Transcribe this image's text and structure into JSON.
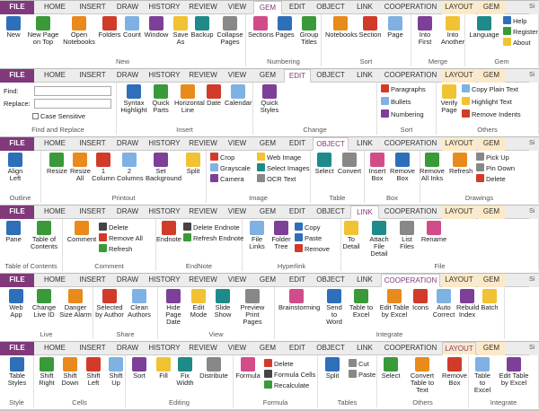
{
  "colors": {
    "file": "#80397b",
    "accent": "#7d3f98"
  },
  "r1": {
    "tabs": [
      "FILE",
      "HOME",
      "INSERT",
      "DRAW",
      "HISTORY",
      "REVIEW",
      "VIEW",
      "GEM",
      "EDIT",
      "OBJECT",
      "LINK",
      "COOPERATION",
      "LAYOUT",
      "GEM"
    ],
    "btns": [
      "New",
      "New Page on Top",
      "Open Notebooks",
      "Folders",
      "Count",
      "Window",
      "Save As",
      "Backup",
      "Collapse Pages",
      "Sections",
      "Pages",
      "Group Titles",
      "Notebooks",
      "Section",
      "Page",
      "Into First",
      "Into Another",
      "Language"
    ],
    "small": [
      "Help",
      "Register",
      "About"
    ],
    "groups": [
      "New",
      "Numbering",
      "Sort",
      "Merge",
      "Gem"
    ]
  },
  "r2": {
    "tabs": [
      "FILE",
      "HOME",
      "INSERT",
      "DRAW",
      "HISTORY",
      "REVIEW",
      "VIEW",
      "GEM",
      "EDIT",
      "OBJECT",
      "LINK",
      "COOPERATION",
      "LAYOUT",
      "GEM"
    ],
    "find": "Find:",
    "replace": "Replace:",
    "case": "Case Sensitive",
    "btns": [
      "Syntax Highlight",
      "Quick Parts",
      "Horizontal Line",
      "Date",
      "Calendar",
      "Quick Styles",
      "Verify Page"
    ],
    "small": [
      "Paragraphs",
      "Bullets",
      "Numbering",
      "Copy Plain Text",
      "Highlight Text",
      "Remove Indents"
    ],
    "groups": [
      "Find and Replace",
      "Insert",
      "Change",
      "Sort",
      "Others"
    ]
  },
  "r3": {
    "tabs": [
      "FILE",
      "HOME",
      "INSERT",
      "DRAW",
      "HISTORY",
      "REVIEW",
      "VIEW",
      "GEM",
      "EDIT",
      "OBJECT",
      "LINK",
      "COOPERATION",
      "LAYOUT",
      "GEM"
    ],
    "btns": [
      "Align Left",
      "Resize",
      "Resize All",
      "1 Column",
      "2 Columns",
      "Set Background",
      "Split",
      "Select",
      "Convert",
      "Insert Box",
      "Remove Box",
      "Remove All Inks",
      "Refresh"
    ],
    "small": [
      "Crop",
      "Grayscale",
      "Camera",
      "Web Image",
      "Select Images",
      "OCR Text",
      "Pick Up",
      "Pin Down",
      "Delete"
    ],
    "groups": [
      "Outline",
      "Printout",
      "Image",
      "Table",
      "Box",
      "Drawings"
    ]
  },
  "r4": {
    "tabs": [
      "FILE",
      "HOME",
      "INSERT",
      "DRAW",
      "HISTORY",
      "REVIEW",
      "VIEW",
      "GEM",
      "EDIT",
      "OBJECT",
      "LINK",
      "COOPERATION",
      "LAYOUT",
      "GEM"
    ],
    "btns": [
      "Pane",
      "Table of Contents",
      "Comment",
      "Endnote",
      "File Links",
      "Folder Tree",
      "To Detail",
      "Attach File Detail",
      "List Files",
      "Rename"
    ],
    "small": [
      "Delete",
      "Remove All",
      "Refresh",
      "Delete Endnote",
      "Refresh Endnote",
      "Copy",
      "Paste",
      "Remove"
    ],
    "groups": [
      "Table of Contents",
      "Comment",
      "EndNote",
      "Hyperlink",
      "File"
    ]
  },
  "r5": {
    "tabs": [
      "FILE",
      "HOME",
      "INSERT",
      "DRAW",
      "HISTORY",
      "REVIEW",
      "VIEW",
      "GEM",
      "EDIT",
      "OBJECT",
      "LINK",
      "COOPERATION",
      "LAYOUT",
      "GEM"
    ],
    "btns": [
      "Web App",
      "Change Live ID",
      "Danger Size Alarm",
      "Selected by Author",
      "Clean Authors",
      "Hide Page Date",
      "Edit Mode",
      "Slide Show",
      "Preview Print Pages",
      "Brainstorming",
      "Send to Word",
      "Table to Excel",
      "Edit Table by Excel",
      "Icons",
      "Auto Correct",
      "Rebuild Index",
      "Batch"
    ],
    "groups": [
      "Live",
      "Share",
      "View",
      "Integrate"
    ]
  },
  "r6": {
    "tabs": [
      "FILE",
      "HOME",
      "INSERT",
      "DRAW",
      "HISTORY",
      "REVIEW",
      "VIEW",
      "GEM",
      "EDIT",
      "OBJECT",
      "LINK",
      "COOPERATION",
      "LAYOUT",
      "GEM"
    ],
    "btns": [
      "Table Styles",
      "Shift Right",
      "Shift Down",
      "Shift Left",
      "Shift Up",
      "Sort",
      "Fill",
      "Fix Width",
      "Distribute",
      "Formula",
      "Split",
      "Select",
      "Convert Table to Text",
      "Remove Box",
      "Table to Excel",
      "Edit Table by Excel"
    ],
    "small": [
      "Delete",
      "Formula Cells",
      "Recalculate",
      "Cut",
      "Paste"
    ],
    "groups": [
      "Style",
      "Cells",
      "Editing",
      "Formula",
      "Tables",
      "Others",
      "Integrate"
    ]
  }
}
